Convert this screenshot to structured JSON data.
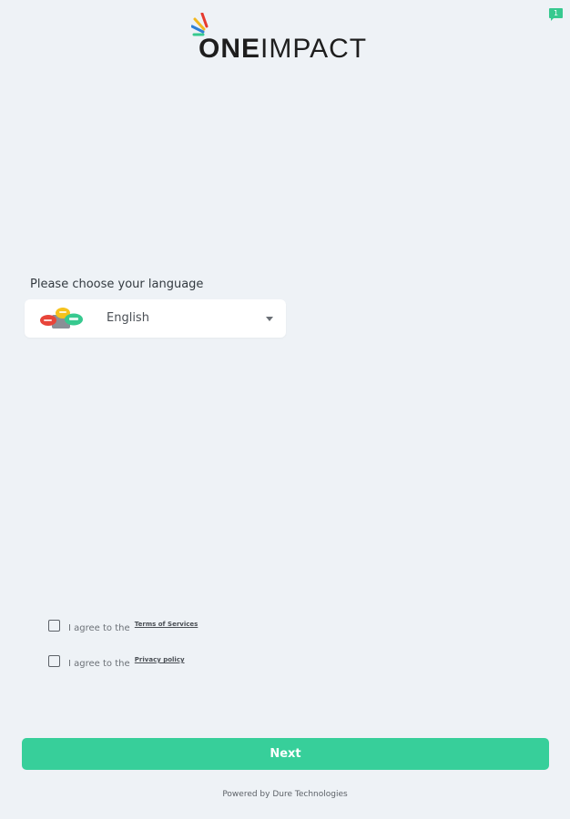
{
  "notification": {
    "count": "1"
  },
  "brand": {
    "one": "ONE",
    "impact": "IMPACT"
  },
  "language": {
    "label": "Please choose your language",
    "selected": "English"
  },
  "agreements": [
    {
      "prefix": "I agree to the",
      "link": "Terms of Services"
    },
    {
      "prefix": "I agree to the",
      "link": "Privacy policy"
    }
  ],
  "actions": {
    "next_label": "Next"
  },
  "footer": {
    "powered_by": "Powered by Dure Technologies"
  },
  "colors": {
    "background": "#eef2f6",
    "accent": "#37cf9a",
    "badge": "#37c98f"
  }
}
